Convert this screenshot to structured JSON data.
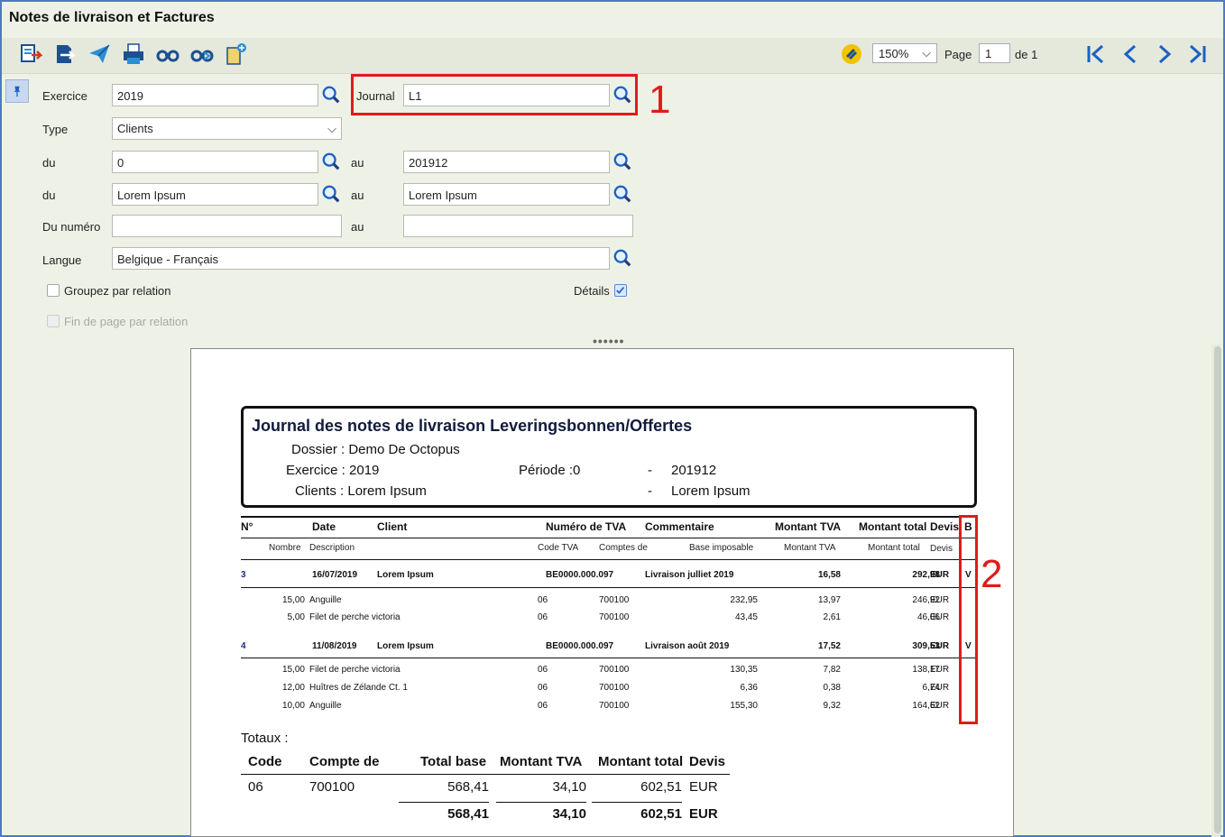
{
  "window": {
    "title": "Notes de livraison et Factures"
  },
  "toolbar": {
    "icons": [
      "export-icon",
      "import-icon",
      "send-icon",
      "print-icon",
      "search-binoculars-icon",
      "search-next-icon",
      "new-doc-icon"
    ],
    "zoom": "150%",
    "page_label": "Page",
    "page_value": "1",
    "page_of": "de 1"
  },
  "form": {
    "exercice_label": "Exercice",
    "exercice_value": "2019",
    "journal_label": "Journal",
    "journal_value": "L1",
    "type_label": "Type",
    "type_value": "Clients",
    "du1_label": "du",
    "du1_value": "0",
    "au1_label": "au",
    "au1_value": "201912",
    "du2_label": "du",
    "du2_value": "Lorem Ipsum",
    "au2_label": "au",
    "au2_value": "Lorem Ipsum",
    "dunum_label": "Du numéro",
    "dunum_value": "",
    "au3_label": "au",
    "au3_value": "",
    "langue_label": "Langue",
    "langue_value": "Belgique - Français",
    "groupez_label": "Groupez par relation",
    "details_label": "Détails",
    "finpage_label": "Fin de page par relation"
  },
  "annotations": {
    "one": "1",
    "two": "2"
  },
  "report": {
    "title": "Journal des notes de livraison Leveringsbonnen/Offertes",
    "dossier": "Dossier : Demo De Octopus",
    "exercice": "Exercice : 2019",
    "periode": "Période :0",
    "dash1": "-",
    "periode_to": "201912",
    "clients": "Clients : Lorem Ipsum",
    "dash2": "-",
    "clients_to": "Lorem Ipsum",
    "headers": {
      "n": "N°",
      "date": "Date",
      "client": "Client",
      "tva": "Numéro de TVA",
      "commentaire": "Commentaire",
      "montant_tva": "Montant TVA",
      "montant_total": "Montant total",
      "devis": "Devis",
      "b": "B"
    },
    "subheaders": {
      "nombre": "Nombre",
      "description": "Description",
      "code_tva": "Code TVA",
      "comptes_de": "Comptes de",
      "base": "Base imposable",
      "montant_tva": "Montant TVA",
      "montant_total": "Montant total",
      "devis": "Devis"
    },
    "groups": [
      {
        "n": "3",
        "date": "16/07/2019",
        "client": "Lorem Ipsum",
        "tva": "BE0000.000.097",
        "commentaire": "Livraison julliet 2019",
        "montant_tva": "16,58",
        "montant_total": "292,98",
        "devis": "EUR",
        "b": "V",
        "lines": [
          {
            "nombre": "15,00",
            "description": "Anguille",
            "code": "06",
            "compte": "700100",
            "base": "232,95",
            "tva": "13,97",
            "total": "246,92",
            "devis": "EUR"
          },
          {
            "nombre": "5,00",
            "description": "Filet de perche victoria",
            "code": "06",
            "compte": "700100",
            "base": "43,45",
            "tva": "2,61",
            "total": "46,06",
            "devis": "EUR"
          }
        ]
      },
      {
        "n": "4",
        "date": "11/08/2019",
        "client": "Lorem Ipsum",
        "tva": "BE0000.000.097",
        "commentaire": "Livraison août 2019",
        "montant_tva": "17,52",
        "montant_total": "309,53",
        "devis": "EUR",
        "b": "V",
        "lines": [
          {
            "nombre": "15,00",
            "description": "Filet de perche victoria",
            "code": "06",
            "compte": "700100",
            "base": "130,35",
            "tva": "7,82",
            "total": "138,17",
            "devis": "EUR"
          },
          {
            "nombre": "12,00",
            "description": "Huîtres de Zélande Ct. 1",
            "code": "06",
            "compte": "700100",
            "base": "6,36",
            "tva": "0,38",
            "total": "6,74",
            "devis": "EUR"
          },
          {
            "nombre": "10,00",
            "description": "Anguille",
            "code": "06",
            "compte": "700100",
            "base": "155,30",
            "tva": "9,32",
            "total": "164,62",
            "devis": "EUR"
          }
        ]
      }
    ],
    "totaux": {
      "label": "Totaux :",
      "headers": {
        "code": "Code",
        "compte": "Compte de",
        "base": "Total base",
        "tva": "Montant TVA",
        "total": "Montant total",
        "devis": "Devis"
      },
      "row": {
        "code": "06",
        "compte": "700100",
        "base": "568,41",
        "tva": "34,10",
        "total": "602,51",
        "devis": "EUR"
      },
      "sum": {
        "base": "568,41",
        "tva": "34,10",
        "total": "602,51",
        "devis": "EUR"
      }
    }
  }
}
